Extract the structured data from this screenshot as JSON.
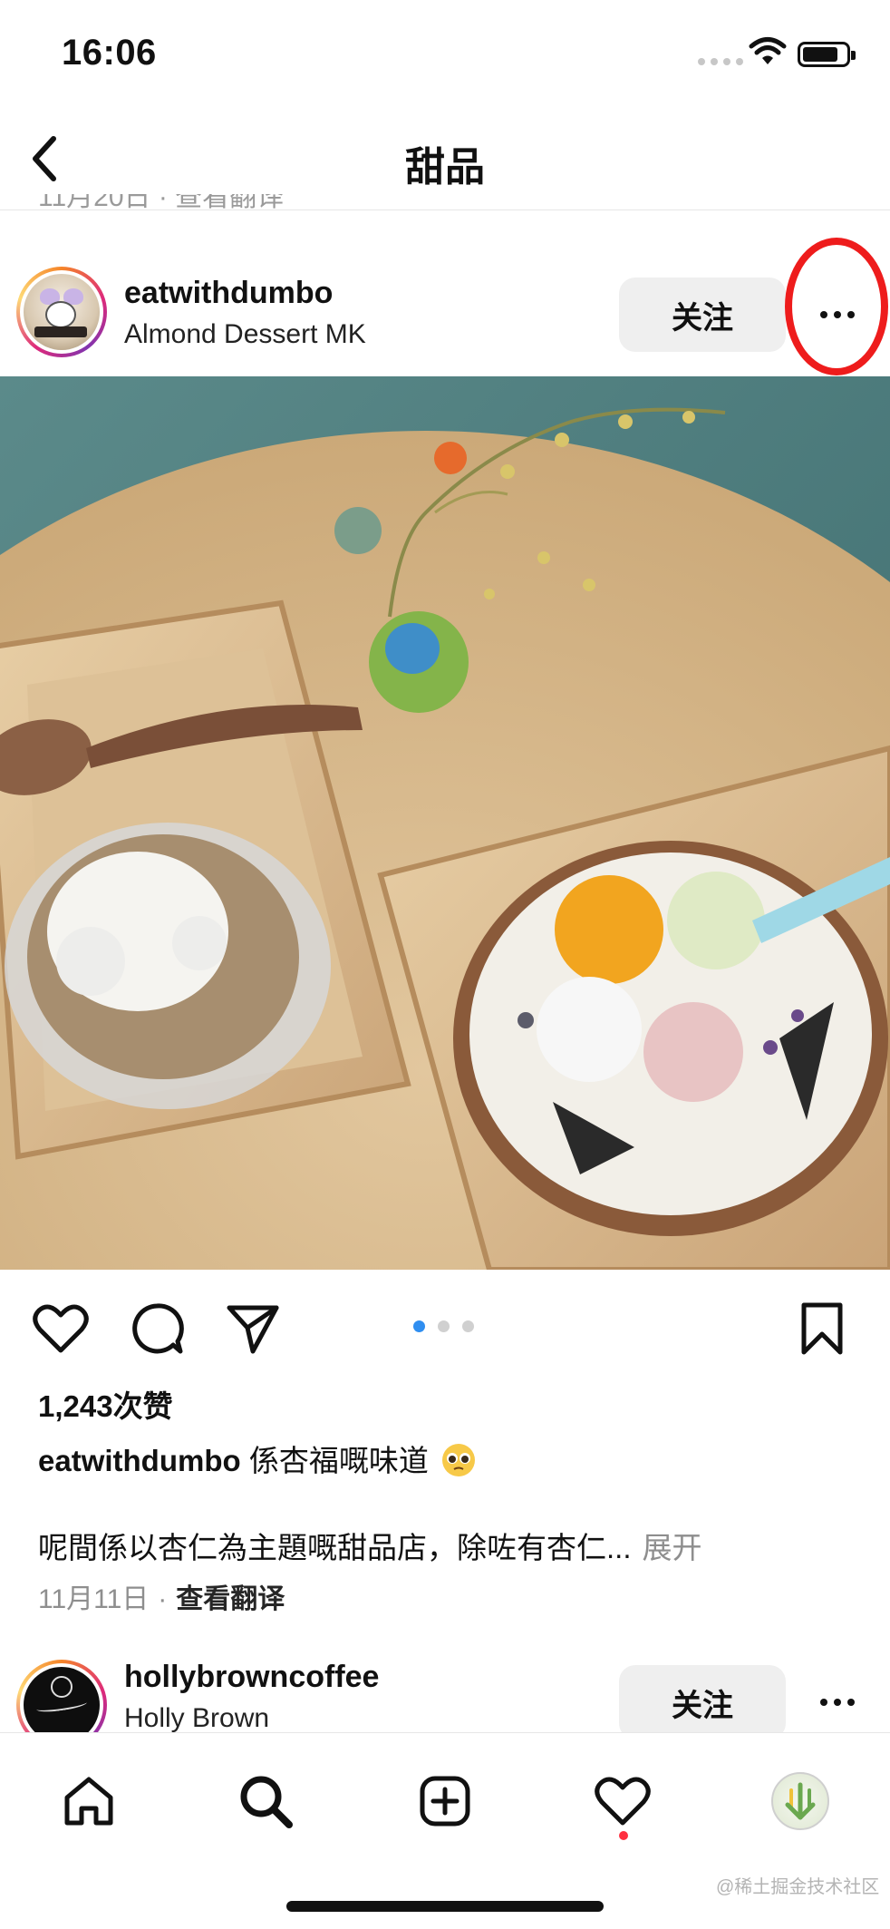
{
  "status_bar": {
    "time": "16:06"
  },
  "header": {
    "title": "甜品",
    "peek_text": "11月20日 · 查看翻译"
  },
  "post": {
    "username": "eatwithdumbo",
    "location": "Almond Dessert MK",
    "follow_label": "关注",
    "carousel": {
      "count": 3,
      "active_index": 0
    },
    "likes": "1,243次赞",
    "caption_handle": "eatwithdumbo",
    "caption_text": "係杏福嘅味道",
    "body_text": "呢間係以杏仁為主題嘅甜品店，除咗有杏仁...",
    "more_label": "展开",
    "date": "11月11日",
    "separator": "·",
    "translate_label": "查看翻译"
  },
  "next_post": {
    "username": "hollybrowncoffee",
    "location": "Holly Brown",
    "follow_label": "关注"
  },
  "colors": {
    "annotation": "#ee1c1c",
    "carousel_active": "#2f8ef0",
    "notification": "#ff3040"
  },
  "icons": [
    "back-icon",
    "more-icon",
    "heart-icon",
    "comment-icon",
    "share-icon",
    "bookmark-icon",
    "home-icon",
    "search-icon",
    "add-icon",
    "activity-icon",
    "profile-icon"
  ],
  "watermark": "@稀土掘金技术社区"
}
